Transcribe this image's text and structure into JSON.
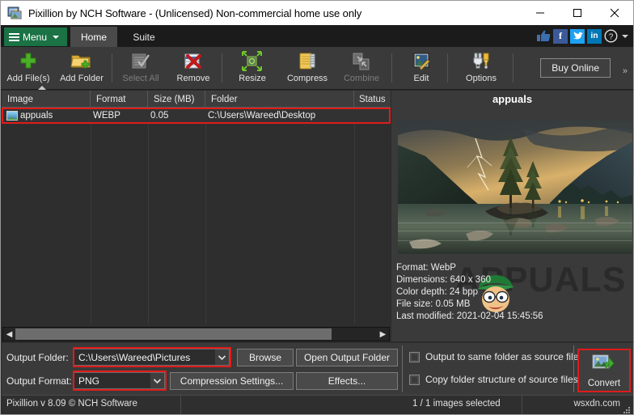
{
  "window": {
    "title": "Pixillion by NCH Software - (Unlicensed) Non-commercial home use only",
    "icon": "pixillion-app-icon",
    "minimize": "minimize-icon",
    "maximize": "maximize-icon",
    "close": "close-icon"
  },
  "menustrip": {
    "menu_label": "Menu",
    "tabs": [
      {
        "label": "Home",
        "active": true
      },
      {
        "label": "Suite",
        "active": false
      }
    ],
    "social": [
      {
        "name": "thumbs-up-icon",
        "glyph": "👍"
      },
      {
        "name": "facebook-icon",
        "glyph": "f"
      },
      {
        "name": "twitter-icon",
        "glyph": "❧"
      },
      {
        "name": "linkedin-icon",
        "glyph": "in"
      },
      {
        "name": "help-icon",
        "glyph": "?"
      }
    ]
  },
  "toolbar": {
    "buttons": [
      {
        "label": "Add File(s)",
        "icon": "green-plus-icon",
        "disabled": false
      },
      {
        "label": "Add Folder",
        "icon": "folder-plus-icon",
        "disabled": false
      },
      {
        "label": "Select All",
        "icon": "select-all-icon",
        "disabled": true
      },
      {
        "label": "Remove",
        "icon": "remove-red-x-icon",
        "disabled": false
      },
      {
        "label": "Resize",
        "icon": "resize-arrows-icon",
        "disabled": false
      },
      {
        "label": "Compress",
        "icon": "compress-zip-icon",
        "disabled": false
      },
      {
        "label": "Combine",
        "icon": "combine-pages-icon",
        "disabled": true
      },
      {
        "label": "Edit",
        "icon": "edit-image-icon",
        "disabled": false
      },
      {
        "label": "Options",
        "icon": "options-tools-icon",
        "disabled": false
      }
    ],
    "buy_online_label": "Buy Online",
    "overflow_label": "»"
  },
  "file_list": {
    "columns": [
      "Image",
      "Format",
      "Size (MB)",
      "Folder",
      "Status"
    ],
    "sorted_column": "Image",
    "rows": [
      {
        "image": "appuals",
        "format": "WEBP",
        "size_mb": "0.05",
        "folder": "C:\\Users\\Wareed\\Desktop",
        "status": "",
        "selected": true,
        "icon": "image-thumbnail-icon"
      }
    ],
    "hscroll_left": "◀",
    "hscroll_right": "▶"
  },
  "preview": {
    "title": "appuals",
    "image_alt": "lake-island-trees-lightning-photo",
    "watermark": "APPUALS",
    "meta": {
      "format": "Format: WebP",
      "dimensions": "Dimensions: 640 x 360",
      "color_depth": "Color depth: 24 bpp",
      "file_size": "File size: 0.05 MB",
      "last_modified": "Last modified: 2021-02-04 15:45:56"
    }
  },
  "bottom": {
    "output_folder_label": "Output Folder:",
    "output_folder_value": "C:\\Users\\Wareed\\Pictures",
    "output_format_label": "Output Format:",
    "output_format_value": "PNG",
    "browse_label": "Browse",
    "open_output_folder_label": "Open Output Folder",
    "compression_settings_label": "Compression Settings...",
    "effects_label": "Effects...",
    "checkboxes": [
      {
        "label": "Output to same folder as source files",
        "checked": false
      },
      {
        "label": "Copy folder structure of source files",
        "checked": false
      }
    ],
    "convert_label": "Convert",
    "convert_icon": "convert-image-arrow-icon"
  },
  "statusbar": {
    "version": "Pixillion v 8.09 © NCH Software",
    "selection": "1 / 1 images selected",
    "source_tag": "wsxdn.com"
  },
  "colors": {
    "accent_green": "#1a7245",
    "highlight_red": "#e01b1b",
    "toolbar_bg": "#3a3a3a",
    "list_bg": "#2e2e2e",
    "titlebar_bg": "#ffffff"
  }
}
